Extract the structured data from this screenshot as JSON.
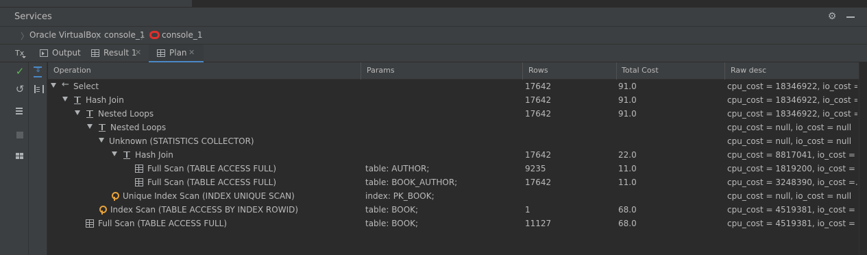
{
  "window": {
    "title": "Services"
  },
  "breadcrumb": [
    "Oracle VirtualBox",
    "console_1",
    "console_1"
  ],
  "toolbar": {
    "tx_label": "Tx"
  },
  "tabs": [
    {
      "label": "Output",
      "icon": "output-icon",
      "closable": false,
      "active": false
    },
    {
      "label": "Result 1",
      "icon": "table-icon",
      "closable": true,
      "active": false
    },
    {
      "label": "Plan",
      "icon": "table-icon",
      "closable": true,
      "active": true
    }
  ],
  "colors": {
    "accent": "#4a88c7",
    "key": "#e8a33a",
    "oracle": "#e0302d",
    "commit": "#5fb85a"
  },
  "table": {
    "columns": [
      "Operation",
      "Params",
      "Rows",
      "Total Cost",
      "Raw desc"
    ],
    "rows": [
      {
        "op": "Select",
        "icon": "select-arrow-icon",
        "params": "",
        "rows": "17642",
        "cost": "91.0",
        "raw": "cpu_cost = 18346922, io_cost = ..."
      },
      {
        "op": "Hash Join",
        "icon": "join-icon",
        "params": "",
        "rows": "17642",
        "cost": "91.0",
        "raw": "cpu_cost = 18346922, io_cost = ..."
      },
      {
        "op": "Nested Loops",
        "icon": "join-icon",
        "params": "",
        "rows": "17642",
        "cost": "91.0",
        "raw": "cpu_cost = 18346922, io_cost = ..."
      },
      {
        "op": "Nested Loops",
        "icon": "join-icon",
        "params": "",
        "rows": "",
        "cost": "",
        "raw": "cpu_cost = null, io_cost = null"
      },
      {
        "op": "Unknown (STATISTICS COLLECTOR)",
        "icon": "",
        "params": "",
        "rows": "",
        "cost": "",
        "raw": "cpu_cost = null, io_cost = null"
      },
      {
        "op": "Hash Join",
        "icon": "join-icon",
        "params": "",
        "rows": "17642",
        "cost": "22.0",
        "raw": "cpu_cost = 8817041, io_cost = ..."
      },
      {
        "op": "Full Scan (TABLE ACCESS FULL)",
        "icon": "table-icon",
        "params": "table: AUTHOR;",
        "rows": "9235",
        "cost": "11.0",
        "raw": "cpu_cost = 1819200, io_cost = ..."
      },
      {
        "op": "Full Scan (TABLE ACCESS FULL)",
        "icon": "table-icon",
        "params": "table: BOOK_AUTHOR;",
        "rows": "17642",
        "cost": "11.0",
        "raw": "cpu_cost = 3248390, io_cost =..."
      },
      {
        "op": "Unique Index Scan (INDEX UNIQUE SCAN)",
        "icon": "key-icon",
        "params": "index: PK_BOOK;",
        "rows": "",
        "cost": "",
        "raw": "cpu_cost = null, io_cost = null"
      },
      {
        "op": "Index Scan (TABLE ACCESS BY INDEX ROWID)",
        "icon": "key-icon",
        "params": "table: BOOK;",
        "rows": "1",
        "cost": "68.0",
        "raw": "cpu_cost = 4519381, io_cost = ..."
      },
      {
        "op": "Full Scan (TABLE ACCESS FULL)",
        "icon": "table-icon",
        "params": "table: BOOK;",
        "rows": "11127",
        "cost": "68.0",
        "raw": "cpu_cost = 4519381, io_cost = ..."
      }
    ]
  }
}
